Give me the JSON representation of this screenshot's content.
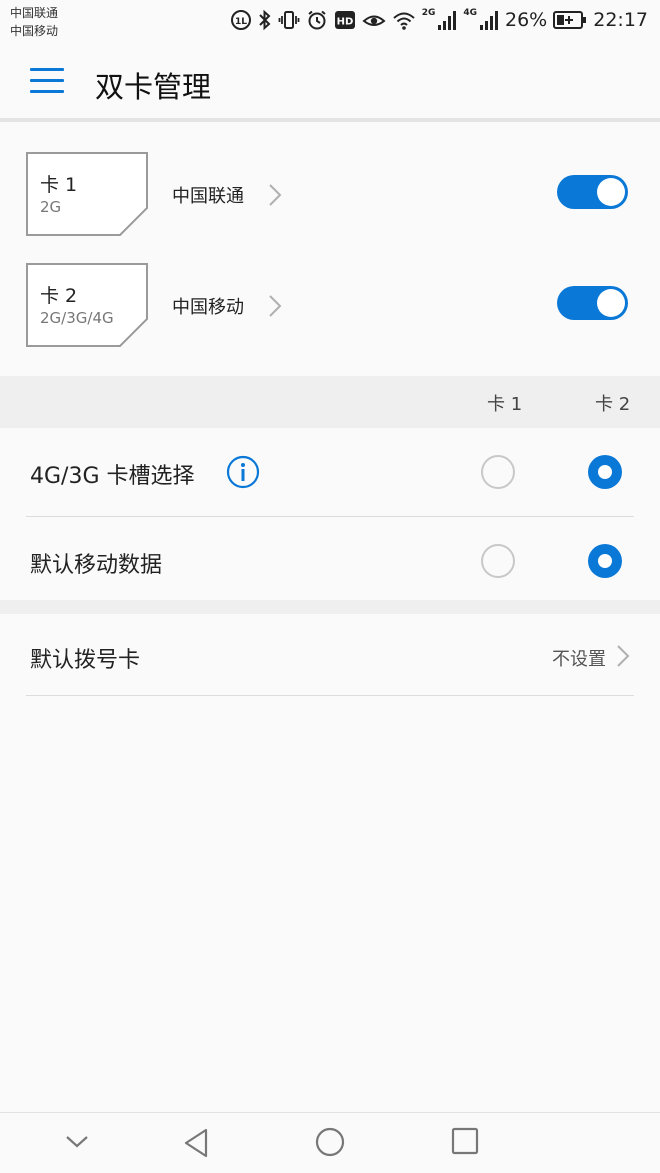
{
  "status_bar": {
    "carrier_1": "中国联通",
    "carrier_2": "中国移动",
    "net_label_1": "2G",
    "net_label_2": "4G",
    "battery": "26%",
    "time": "22:17"
  },
  "app_bar": {
    "title": "双卡管理"
  },
  "sims": [
    {
      "name": "卡 1",
      "network": "2G",
      "carrier": "中国联通",
      "enabled": true
    },
    {
      "name": "卡 2",
      "network": "2G/3G/4G",
      "carrier": "中国移动",
      "enabled": true
    }
  ],
  "columns": {
    "card1": "卡 1",
    "card2": "卡 2"
  },
  "options": [
    {
      "label": "4G/3G 卡槽选择",
      "selected": "卡 2"
    },
    {
      "label": "默认移动数据",
      "selected": "卡 2"
    }
  ],
  "default_dial": {
    "label": "默认拨号卡",
    "value": "不设置"
  },
  "colors": {
    "accent": "#0a78d7",
    "background": "#fafafa",
    "section": "#efefef"
  },
  "icons": {
    "menu": "menu-icon",
    "info": "info-icon",
    "chevron": "chevron-right-icon",
    "nav_down": "chevron-down-icon",
    "nav_back": "back-triangle-icon",
    "nav_home": "home-circle-icon",
    "nav_recent": "recent-square-icon"
  }
}
